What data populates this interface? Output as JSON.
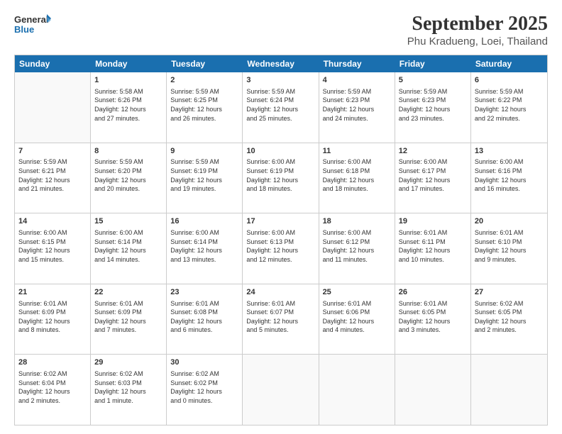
{
  "logo": {
    "line1": "General",
    "line2": "Blue"
  },
  "title": "September 2025",
  "subtitle": "Phu Kradueng, Loei, Thailand",
  "weekdays": [
    "Sunday",
    "Monday",
    "Tuesday",
    "Wednesday",
    "Thursday",
    "Friday",
    "Saturday"
  ],
  "weeks": [
    [
      {
        "day": "",
        "info": ""
      },
      {
        "day": "1",
        "info": "Sunrise: 5:58 AM\nSunset: 6:26 PM\nDaylight: 12 hours\nand 27 minutes."
      },
      {
        "day": "2",
        "info": "Sunrise: 5:59 AM\nSunset: 6:25 PM\nDaylight: 12 hours\nand 26 minutes."
      },
      {
        "day": "3",
        "info": "Sunrise: 5:59 AM\nSunset: 6:24 PM\nDaylight: 12 hours\nand 25 minutes."
      },
      {
        "day": "4",
        "info": "Sunrise: 5:59 AM\nSunset: 6:23 PM\nDaylight: 12 hours\nand 24 minutes."
      },
      {
        "day": "5",
        "info": "Sunrise: 5:59 AM\nSunset: 6:23 PM\nDaylight: 12 hours\nand 23 minutes."
      },
      {
        "day": "6",
        "info": "Sunrise: 5:59 AM\nSunset: 6:22 PM\nDaylight: 12 hours\nand 22 minutes."
      }
    ],
    [
      {
        "day": "7",
        "info": "Sunrise: 5:59 AM\nSunset: 6:21 PM\nDaylight: 12 hours\nand 21 minutes."
      },
      {
        "day": "8",
        "info": "Sunrise: 5:59 AM\nSunset: 6:20 PM\nDaylight: 12 hours\nand 20 minutes."
      },
      {
        "day": "9",
        "info": "Sunrise: 5:59 AM\nSunset: 6:19 PM\nDaylight: 12 hours\nand 19 minutes."
      },
      {
        "day": "10",
        "info": "Sunrise: 6:00 AM\nSunset: 6:19 PM\nDaylight: 12 hours\nand 18 minutes."
      },
      {
        "day": "11",
        "info": "Sunrise: 6:00 AM\nSunset: 6:18 PM\nDaylight: 12 hours\nand 18 minutes."
      },
      {
        "day": "12",
        "info": "Sunrise: 6:00 AM\nSunset: 6:17 PM\nDaylight: 12 hours\nand 17 minutes."
      },
      {
        "day": "13",
        "info": "Sunrise: 6:00 AM\nSunset: 6:16 PM\nDaylight: 12 hours\nand 16 minutes."
      }
    ],
    [
      {
        "day": "14",
        "info": "Sunrise: 6:00 AM\nSunset: 6:15 PM\nDaylight: 12 hours\nand 15 minutes."
      },
      {
        "day": "15",
        "info": "Sunrise: 6:00 AM\nSunset: 6:14 PM\nDaylight: 12 hours\nand 14 minutes."
      },
      {
        "day": "16",
        "info": "Sunrise: 6:00 AM\nSunset: 6:14 PM\nDaylight: 12 hours\nand 13 minutes."
      },
      {
        "day": "17",
        "info": "Sunrise: 6:00 AM\nSunset: 6:13 PM\nDaylight: 12 hours\nand 12 minutes."
      },
      {
        "day": "18",
        "info": "Sunrise: 6:00 AM\nSunset: 6:12 PM\nDaylight: 12 hours\nand 11 minutes."
      },
      {
        "day": "19",
        "info": "Sunrise: 6:01 AM\nSunset: 6:11 PM\nDaylight: 12 hours\nand 10 minutes."
      },
      {
        "day": "20",
        "info": "Sunrise: 6:01 AM\nSunset: 6:10 PM\nDaylight: 12 hours\nand 9 minutes."
      }
    ],
    [
      {
        "day": "21",
        "info": "Sunrise: 6:01 AM\nSunset: 6:09 PM\nDaylight: 12 hours\nand 8 minutes."
      },
      {
        "day": "22",
        "info": "Sunrise: 6:01 AM\nSunset: 6:09 PM\nDaylight: 12 hours\nand 7 minutes."
      },
      {
        "day": "23",
        "info": "Sunrise: 6:01 AM\nSunset: 6:08 PM\nDaylight: 12 hours\nand 6 minutes."
      },
      {
        "day": "24",
        "info": "Sunrise: 6:01 AM\nSunset: 6:07 PM\nDaylight: 12 hours\nand 5 minutes."
      },
      {
        "day": "25",
        "info": "Sunrise: 6:01 AM\nSunset: 6:06 PM\nDaylight: 12 hours\nand 4 minutes."
      },
      {
        "day": "26",
        "info": "Sunrise: 6:01 AM\nSunset: 6:05 PM\nDaylight: 12 hours\nand 3 minutes."
      },
      {
        "day": "27",
        "info": "Sunrise: 6:02 AM\nSunset: 6:05 PM\nDaylight: 12 hours\nand 2 minutes."
      }
    ],
    [
      {
        "day": "28",
        "info": "Sunrise: 6:02 AM\nSunset: 6:04 PM\nDaylight: 12 hours\nand 2 minutes."
      },
      {
        "day": "29",
        "info": "Sunrise: 6:02 AM\nSunset: 6:03 PM\nDaylight: 12 hours\nand 1 minute."
      },
      {
        "day": "30",
        "info": "Sunrise: 6:02 AM\nSunset: 6:02 PM\nDaylight: 12 hours\nand 0 minutes."
      },
      {
        "day": "",
        "info": ""
      },
      {
        "day": "",
        "info": ""
      },
      {
        "day": "",
        "info": ""
      },
      {
        "day": "",
        "info": ""
      }
    ]
  ]
}
